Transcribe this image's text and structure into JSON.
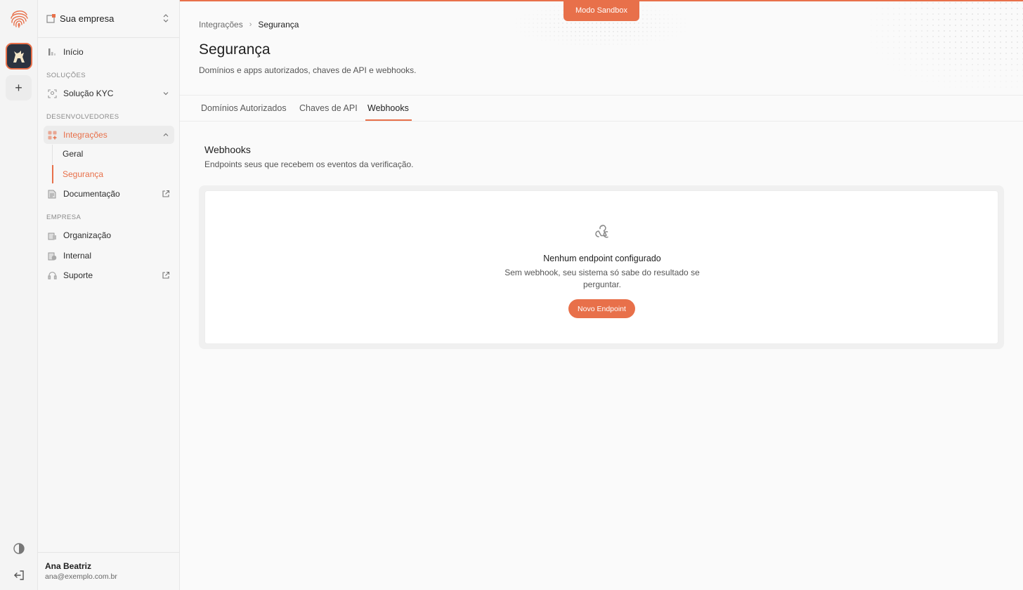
{
  "colors": {
    "accent": "#e8704a",
    "text": "#1f1f1f",
    "muted": "#555555"
  },
  "company": {
    "name": "Sua empresa"
  },
  "sidebar": {
    "home": "Início",
    "sections": {
      "solutions": "SOLUÇÕES",
      "developers": "DESENVOLVEDORES",
      "company": "EMPRESA"
    },
    "kyc": "Solução KYC",
    "integrations": "Integrações",
    "integrations_sub": [
      "Geral",
      "Segurança"
    ],
    "docs": "Documentação",
    "organization": "Organização",
    "internal": "Internal",
    "support": "Suporte"
  },
  "user": {
    "name": "Ana Beatriz",
    "email": "ana@exemplo.com.br"
  },
  "banner": {
    "sandbox": "Modo Sandbox"
  },
  "breadcrumb": {
    "parent": "Integrações",
    "current": "Segurança"
  },
  "page": {
    "title": "Segurança",
    "subtitle": "Domínios e apps autorizados, chaves de API e webhooks."
  },
  "tabs": [
    {
      "label": "Domínios Autorizados"
    },
    {
      "label": "Chaves de API"
    },
    {
      "label": "Webhooks",
      "active": true
    }
  ],
  "webhooks": {
    "title": "Webhooks",
    "subtitle": "Endpoints seus que recebem os eventos da verificação.",
    "empty_title": "Nenhum endpoint configurado",
    "empty_text": "Sem webhook, seu sistema só sabe do resultado se perguntar.",
    "button": "Novo Endpoint"
  },
  "icons": [
    "fingerprint-logo-icon",
    "org-avatar-icon",
    "plus-icon",
    "chevrons-up-down-icon",
    "bar-chart-icon",
    "scan-face-icon",
    "chevron-down-icon",
    "grid-icon",
    "chevron-up-icon",
    "document-icon",
    "external-link-icon",
    "building-icon",
    "globe-icon",
    "headset-icon",
    "theme-icon",
    "logout-icon",
    "webhook-icon"
  ]
}
